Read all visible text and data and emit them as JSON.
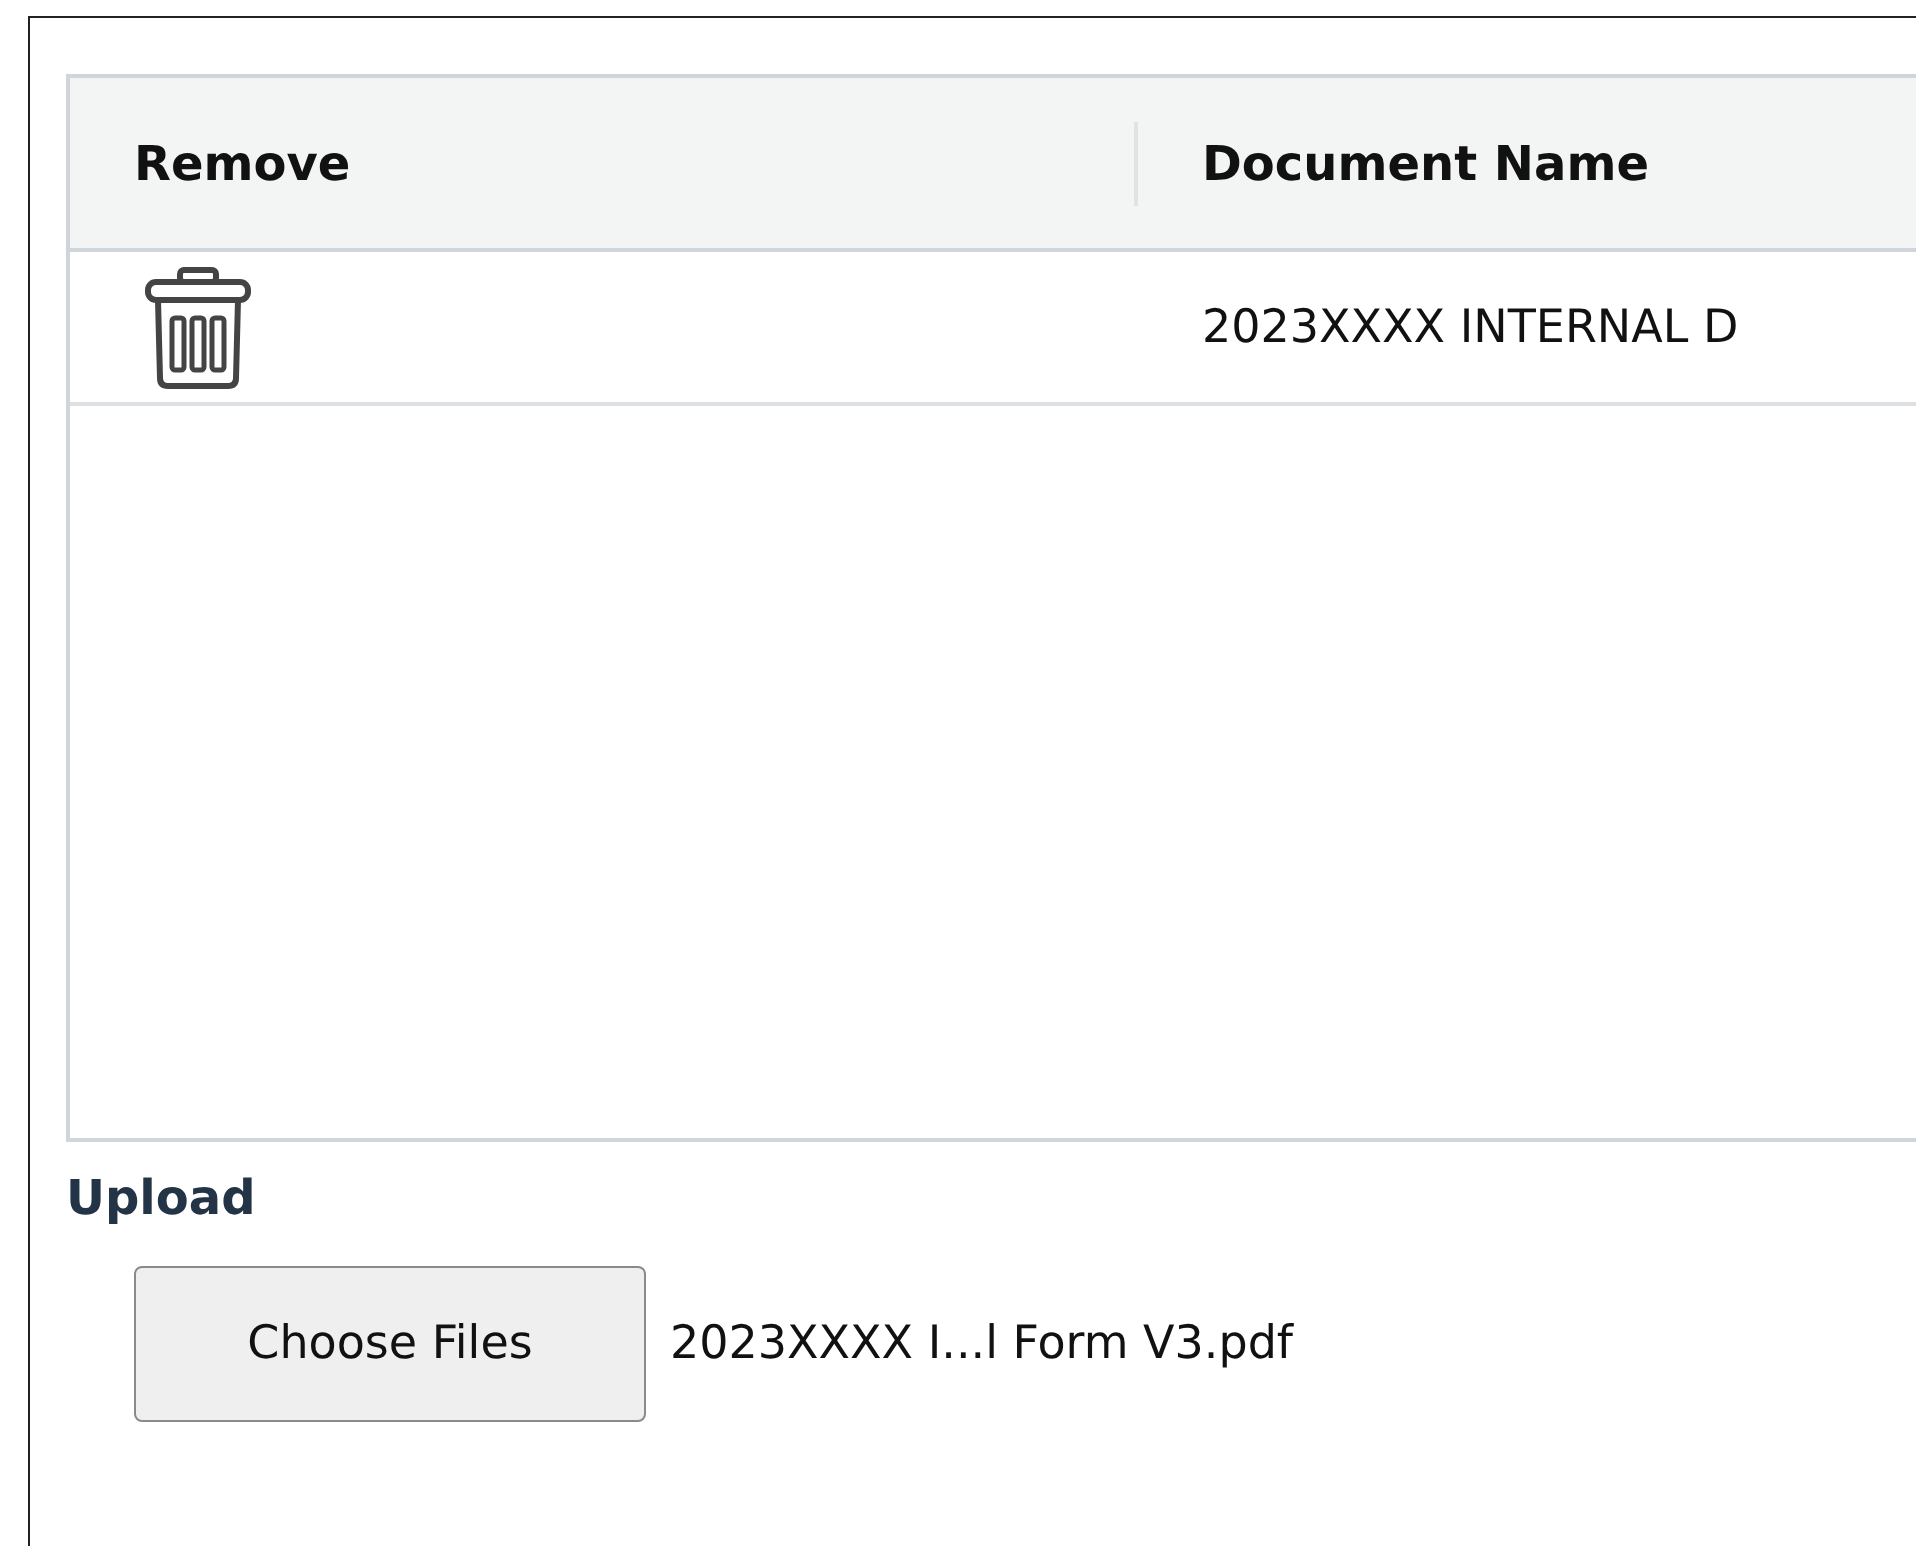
{
  "table": {
    "columns": [
      "Remove",
      "Document Name"
    ],
    "rows": [
      {
        "document_name": "2023XXXX INTERNAL D"
      }
    ]
  },
  "upload": {
    "label": "Upload",
    "button": "Choose Files",
    "file_name": "2023XXXX I...l Form V3.pdf"
  }
}
